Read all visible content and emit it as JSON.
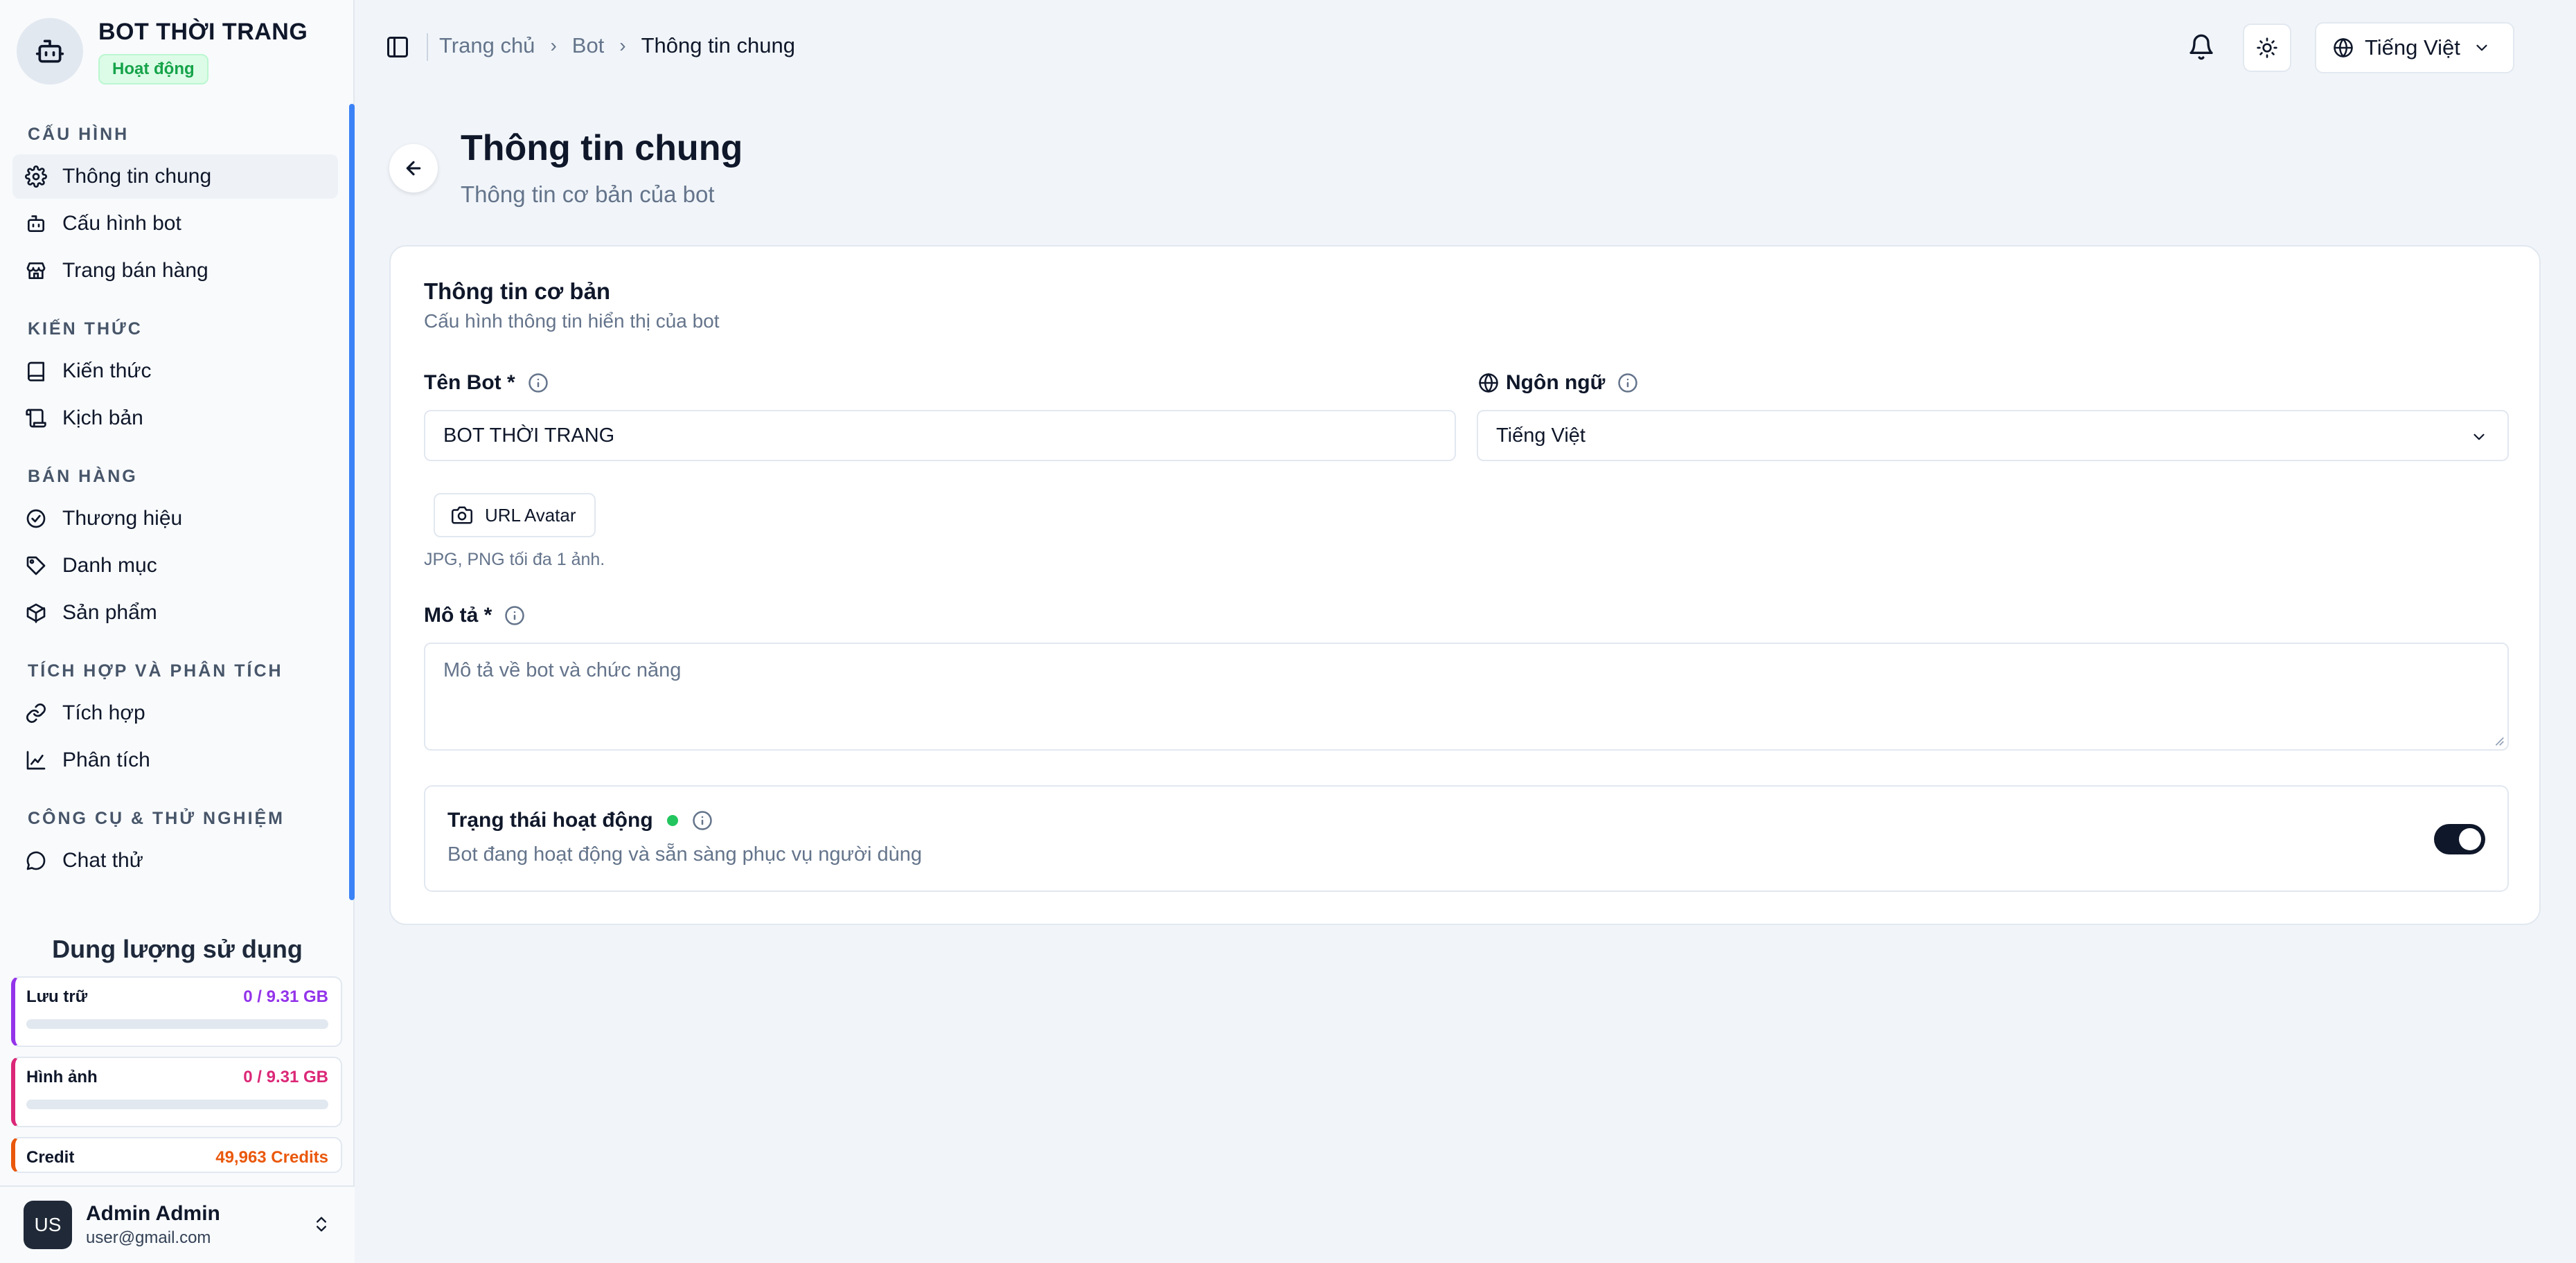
{
  "brand": {
    "name": "BOT THỜI TRANG",
    "status": "Hoạt động"
  },
  "sidebar": {
    "sections": [
      {
        "title": "CẤU HÌNH",
        "items": [
          {
            "label": "Thông tin chung",
            "icon": "gear-icon",
            "active": true
          },
          {
            "label": "Cấu hình bot",
            "icon": "bot-icon"
          },
          {
            "label": "Trang bán hàng",
            "icon": "store-icon"
          }
        ]
      },
      {
        "title": "KIẾN THỨC",
        "items": [
          {
            "label": "Kiến thức",
            "icon": "book-icon"
          },
          {
            "label": "Kịch bản",
            "icon": "scroll-icon"
          }
        ]
      },
      {
        "title": "BÁN HÀNG",
        "items": [
          {
            "label": "Thương hiệu",
            "icon": "badge-check-icon"
          },
          {
            "label": "Danh mục",
            "icon": "tags-icon"
          },
          {
            "label": "Sản phẩm",
            "icon": "box-icon"
          }
        ]
      },
      {
        "title": "TÍCH HỢP VÀ PHÂN TÍCH",
        "items": [
          {
            "label": "Tích hợp",
            "icon": "link-icon"
          },
          {
            "label": "Phân tích",
            "icon": "chart-line-icon"
          }
        ]
      },
      {
        "title": "CÔNG CỤ & THỬ NGHIỆM",
        "items": [
          {
            "label": "Chat thử",
            "icon": "chat-icon"
          }
        ]
      }
    ]
  },
  "usage": {
    "title": "Dung lượng sử dụng",
    "storage": {
      "label": "Lưu trữ",
      "value": "0 / 9.31 GB",
      "color": "#9333ea",
      "fraction": 0
    },
    "images": {
      "label": "Hình ảnh",
      "value": "0 / 9.31 GB",
      "color": "#db2777",
      "fraction": 0
    },
    "credit": {
      "label": "Credit",
      "value": "49,963 Credits",
      "color": "#ea580c"
    }
  },
  "user": {
    "initials": "US",
    "name": "Admin Admin",
    "email": "user@gmail.com"
  },
  "topbar": {
    "breadcrumb": [
      "Trang chủ",
      "Bot",
      "Thông tin chung"
    ],
    "language": "Tiếng Việt"
  },
  "page": {
    "title": "Thông tin chung",
    "subtitle": "Thông tin cơ bản của bot"
  },
  "card": {
    "title": "Thông tin cơ bản",
    "subtitle": "Cấu hình thông tin hiển thị của bot",
    "name_label": "Tên Bot *",
    "name_value": "BOT THỜI TRANG",
    "language_label": "Ngôn ngữ",
    "language_value": "Tiếng Việt",
    "avatar_button": "URL Avatar",
    "avatar_hint": "JPG, PNG tối đa 1 ảnh.",
    "description_label": "Mô tả *",
    "description_placeholder": "Mô tả về bot và chức năng",
    "status_title": "Trạng thái hoạt động",
    "status_desc": "Bot đang hoạt động và sẵn sàng phục vụ người dùng",
    "status_on": true
  }
}
